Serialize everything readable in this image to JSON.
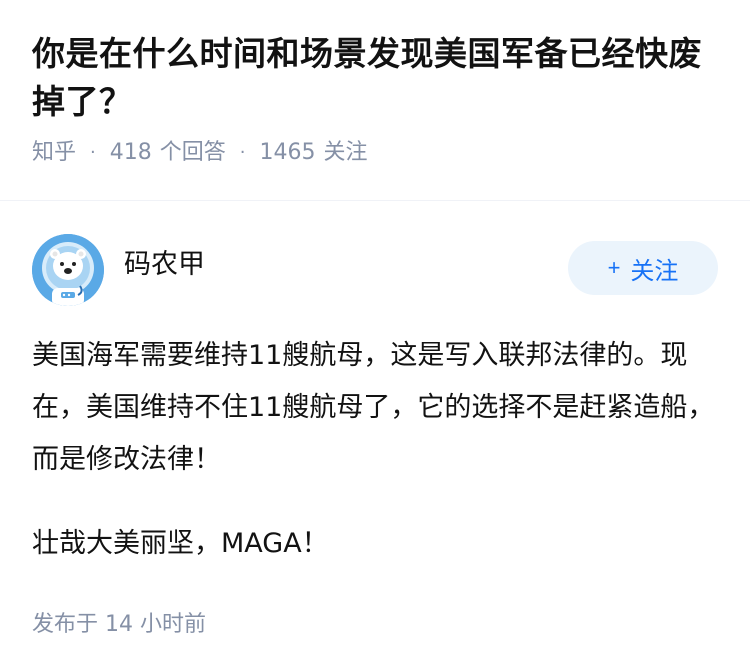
{
  "question": {
    "title": "你是在什么时间和场景发现美国军备已经快废掉了？",
    "meta": {
      "source": "知乎",
      "answers_count": "418",
      "answers_label": "个回答",
      "followers_count": "1465",
      "followers_label": "关注",
      "separator": "·"
    }
  },
  "answer": {
    "author": {
      "name": "码农甲",
      "avatar_icon": "bear-astronaut-avatar"
    },
    "follow_button": {
      "label": "关注",
      "icon": "plus-icon",
      "icon_glyph": "+"
    },
    "paragraphs": [
      "美国海军需要维持11艘航母，这是写入联邦法律的。现在，美国维持不住11艘航母了，它的选择不是赶紧造船，而是修改法律！",
      "壮哉大美丽坚，MAGA！"
    ],
    "footer": {
      "published_label": "发布于",
      "published_time": "14 小时前"
    }
  },
  "colors": {
    "title": "#121212",
    "meta": "#8590a6",
    "accent": "#1772f6",
    "follow_bg": "#ebf4fc",
    "avatar_bg": "#5aa9e6"
  }
}
